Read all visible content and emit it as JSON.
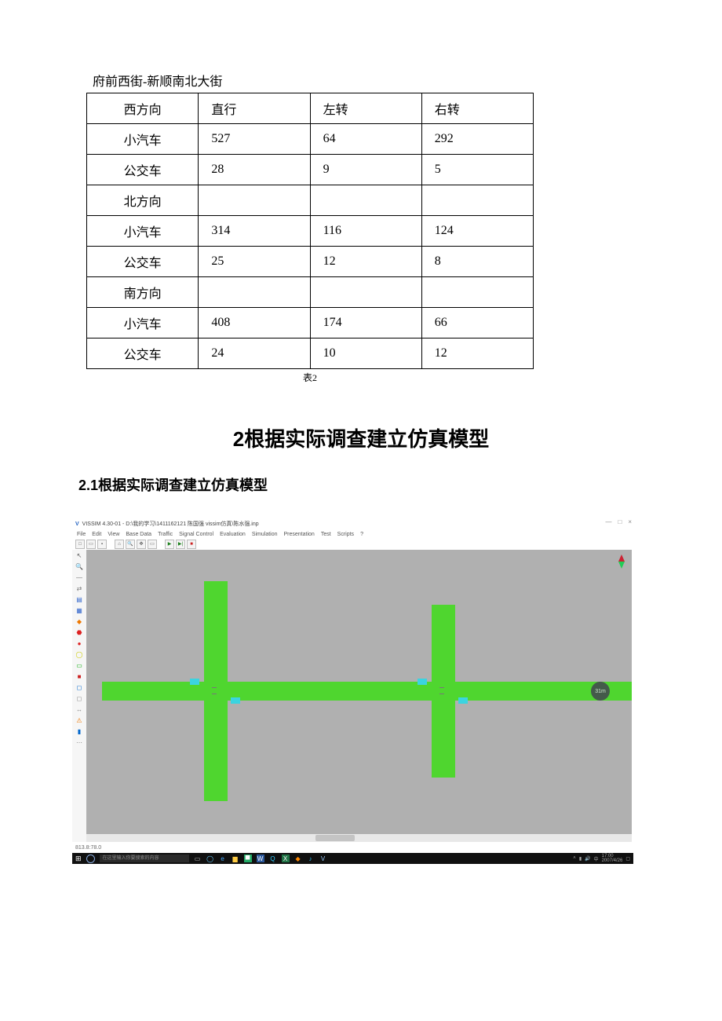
{
  "table": {
    "title": "府前西街-新顺南北大街",
    "headers": [
      "西方向",
      "直行",
      "左转",
      "右转"
    ],
    "rows": [
      {
        "label": "小汽车",
        "c1": "527",
        "c2": "64",
        "c3": "292"
      },
      {
        "label": "公交车",
        "c1": "28",
        "c2": "9",
        "c3": "5"
      },
      {
        "label": "北方向",
        "c1": "",
        "c2": "",
        "c3": ""
      },
      {
        "label": "小汽车",
        "c1": "314",
        "c2": "116",
        "c3": "124"
      },
      {
        "label": "公交车",
        "c1": "25",
        "c2": "12",
        "c3": "8"
      },
      {
        "label": "南方向",
        "c1": "",
        "c2": "",
        "c3": ""
      },
      {
        "label": "小汽车",
        "c1": "408",
        "c2": "174",
        "c3": "66"
      },
      {
        "label": "公交车",
        "c1": "24",
        "c2": "10",
        "c3": "12"
      }
    ],
    "caption": "表2"
  },
  "headings": {
    "h1": "2根据实际调查建立仿真模型",
    "h2": "2.1根据实际调查建立仿真模型"
  },
  "app": {
    "title": "VISSIM 4.30-01 - D:\\我的学习\\1411162121 陈国强 vissim仿真\\陈水强.inp",
    "menus": [
      "File",
      "Edit",
      "View",
      "Base Data",
      "Traffic",
      "Signal Control",
      "Evaluation",
      "Simulation",
      "Presentation",
      "Test",
      "Scripts",
      "?"
    ],
    "status": "813.8:78.0",
    "scale_badge": "31m",
    "search_placeholder": "在这里输入你要搜索的内容",
    "clock": "17:00",
    "date": "2007/4/26",
    "window_controls": {
      "min": "—",
      "max": "□",
      "close": "×"
    }
  },
  "colors": {
    "road": "#4fd62f",
    "stop": "#3bd4e0",
    "canvas": "#b0b0b0",
    "taskbar": "#101010"
  }
}
